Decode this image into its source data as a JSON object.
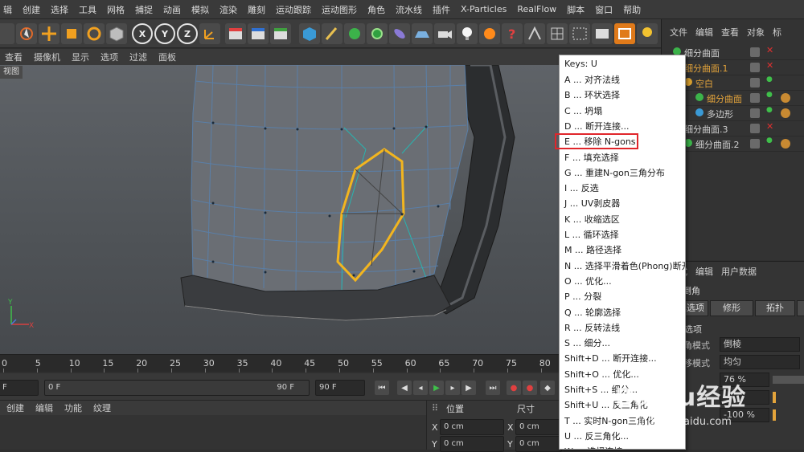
{
  "menubar": {
    "items": [
      "辑",
      "创建",
      "选择",
      "工具",
      "网格",
      "捕捉",
      "动画",
      "模拟",
      "渲染",
      "雕刻",
      "运动跟踪",
      "运动图形",
      "角色",
      "流水线",
      "插件",
      "X-Particles",
      "RealFlow",
      "脚本",
      "窗口",
      "帮助"
    ]
  },
  "toolbar": {
    "axis_x": "X",
    "axis_y": "Y",
    "axis_z": "Z"
  },
  "view_menu": {
    "items": [
      "查看",
      "摄像机",
      "显示",
      "选项",
      "过滤",
      "面板"
    ],
    "label": "视图"
  },
  "timeline": {
    "ticks": [
      "0",
      "5",
      "10",
      "15",
      "20",
      "25",
      "30",
      "35",
      "40",
      "45",
      "50",
      "55",
      "60",
      "65",
      "70",
      "75",
      "80"
    ],
    "start_field": "F",
    "current_field": "0 F",
    "end_field": "90 F",
    "max_field": "90 F"
  },
  "bottom_bar": {
    "items": [
      "创建",
      "编辑",
      "功能",
      "纹理"
    ]
  },
  "coords": {
    "position_label": "位置",
    "size_label": "尺寸",
    "x_label": "X",
    "y_label": "Y",
    "x_pos": "0 cm",
    "y_pos": "0 cm",
    "x_size": "0 cm",
    "y_size": "0 cm"
  },
  "object_panel": {
    "tabs": [
      "文件",
      "编辑",
      "查看",
      "对象",
      "标"
    ],
    "rows": [
      {
        "name": "细分曲面",
        "indent": 0,
        "orange": false,
        "cross": true
      },
      {
        "name": "细分曲面.1",
        "indent": 0,
        "orange": true,
        "cross": true
      },
      {
        "name": "空白",
        "indent": 1,
        "orange": true,
        "cross": false
      },
      {
        "name": "细分曲面",
        "indent": 2,
        "orange": true,
        "cross": false
      },
      {
        "name": "多边形",
        "indent": 2,
        "orange": false,
        "cross": false
      },
      {
        "name": "细分曲面.3",
        "indent": 0,
        "orange": false,
        "cross": true
      },
      {
        "name": "细分曲面.2",
        "indent": 1,
        "orange": false,
        "cross": false
      }
    ]
  },
  "attr_panel": {
    "tabs": [
      "模式",
      "编辑",
      "用户数据"
    ],
    "title": "倒角",
    "subtabs": [
      "工具选项",
      "修形",
      "拓扑",
      "工"
    ],
    "section": "工具选项",
    "rows": [
      {
        "label": "倒角模式",
        "value": "倒棱"
      },
      {
        "label": "偏移模式",
        "value": "均匀"
      },
      {
        "label": "",
        "value": "76 %"
      },
      {
        "label": "",
        "value": ""
      },
      {
        "label": "",
        "value": "-100 %"
      }
    ]
  },
  "popup": {
    "header": "Keys: U",
    "items": [
      "A ... 对齐法线",
      "B ... 环状选择",
      "C ... 坍塌",
      "D ... 断开连接...",
      "E ... 移除 N-gons",
      "F ... 填充选择",
      "G ... 重建N-gon三角分布",
      "I ... 反选",
      "J ... UV剥皮器",
      "K ... 收缩选区",
      "L ... 循环选择",
      "M ... 路径选择",
      "N ... 选择平滑着色(Phong)断开",
      "O ... 优化...",
      "P ... 分裂",
      "Q ... 轮廓选择",
      "R ... 反转法线",
      "S ... 细分...",
      "Shift+D ... 断开连接...",
      "Shift+O ... 优化...",
      "Shift+S ... 细分...",
      "Shift+U ... 反三角化",
      "T ... 实时N-gon三角化",
      "U ... 反三角化...",
      "W ... 选择连接"
    ]
  },
  "watermark": {
    "text": "Baidu经验",
    "url": "jingyan.baidu.com"
  },
  "colors": {
    "accent": "#e4a43b",
    "highlight": "#e0262b",
    "selection": "#f2b51f"
  }
}
